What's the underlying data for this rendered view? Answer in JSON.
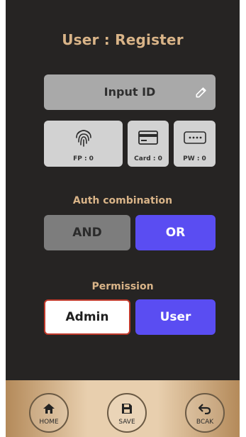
{
  "header": {
    "title": "User : Register"
  },
  "input_id": {
    "label": "Input ID",
    "icon": "edit-icon"
  },
  "auth_methods": [
    {
      "icon": "fingerprint-icon",
      "label": "FP : 0"
    },
    {
      "icon": "card-icon",
      "label": "Card : 0"
    },
    {
      "icon": "password-icon",
      "label": "PW : 0"
    }
  ],
  "auth_combination": {
    "label": "Auth combination",
    "options": [
      "AND",
      "OR"
    ],
    "selected": "OR"
  },
  "permission": {
    "label": "Permission",
    "options": [
      "Admin",
      "User"
    ],
    "selected": "User"
  },
  "nav": [
    {
      "icon": "home-icon",
      "label": "HOME"
    },
    {
      "icon": "save-icon",
      "label": "SAVE"
    },
    {
      "icon": "back-icon",
      "label": "BCAK"
    }
  ],
  "colors": {
    "accent": "#5a4df2",
    "title": "#d9b488",
    "background": "#262423",
    "admin_border": "#c0392b"
  }
}
